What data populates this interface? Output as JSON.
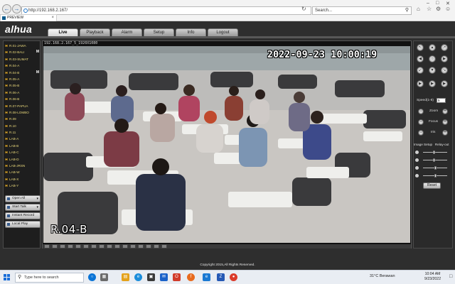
{
  "browser": {
    "url": "http://192.168.2.167/",
    "search_placeholder": "Search...",
    "tab_title": "PREVIEW"
  },
  "app": {
    "logo": "alhua",
    "nav": [
      {
        "label": "Live",
        "active": true
      },
      {
        "label": "Playback",
        "active": false
      },
      {
        "label": "Alarm",
        "active": false
      },
      {
        "label": "Setup",
        "active": false
      },
      {
        "label": "Info",
        "active": false
      },
      {
        "label": "Logout",
        "active": false
      }
    ],
    "channels": [
      {
        "label": "R.01-JAWA",
        "state": ""
      },
      {
        "label": "R.02-BALI",
        "state": "M"
      },
      {
        "label": "R.03-SUMAT",
        "state": ""
      },
      {
        "label": "R.04-A",
        "state": ""
      },
      {
        "label": "R.04-B",
        "state": "M"
      },
      {
        "label": "R.05-A",
        "state": ""
      },
      {
        "label": "R.05-B",
        "state": ""
      },
      {
        "label": "R.06-A",
        "state": ""
      },
      {
        "label": "R.06-B",
        "state": ""
      },
      {
        "label": "R.07-PAPUA",
        "state": ""
      },
      {
        "label": "R.08-LOMBO",
        "state": ""
      },
      {
        "label": "R.09",
        "state": ""
      },
      {
        "label": "R.10",
        "state": ""
      },
      {
        "label": "R.11",
        "state": ""
      },
      {
        "label": "LAB-A",
        "state": ""
      },
      {
        "label": "LAB-B",
        "state": ""
      },
      {
        "label": "LAB-C",
        "state": ""
      },
      {
        "label": "LAB-D",
        "state": ""
      },
      {
        "label": "LAB-JRSN",
        "state": ""
      },
      {
        "label": "LAB-W",
        "state": ""
      },
      {
        "label": "LAB-X",
        "state": ""
      },
      {
        "label": "LAB-Y",
        "state": ""
      }
    ],
    "left_buttons": [
      {
        "label": "Open All",
        "has_dropdown": true
      },
      {
        "label": "Start Talk",
        "has_dropdown": true
      },
      {
        "label": "Instant Record",
        "has_dropdown": false
      },
      {
        "label": "Local Play",
        "has_dropdown": false
      }
    ],
    "video": {
      "info": "192.168.2.167_5_1920X1080",
      "osd_time": "2022-09-23 10:00:19",
      "osd_channel": "R.04-B"
    },
    "ptz": {
      "speed_label": "Speed(1-8)",
      "speed_value": "5",
      "zoom_label": "Zoom",
      "focus_label": "Focus",
      "iris_label": "Iris",
      "image_setup_label": "Image Setup",
      "relay_out_label": "Relay-out",
      "reset_label": "Reset",
      "sliders": [
        0.45,
        0.45,
        0.5,
        0.5
      ]
    },
    "copyright": "Copyright 2015,All Rights Reserved."
  },
  "taskbar": {
    "search_placeholder": "Type here to search",
    "weather": "31°C  Berawan",
    "time": "10:04 AM",
    "date": "9/23/2022"
  }
}
